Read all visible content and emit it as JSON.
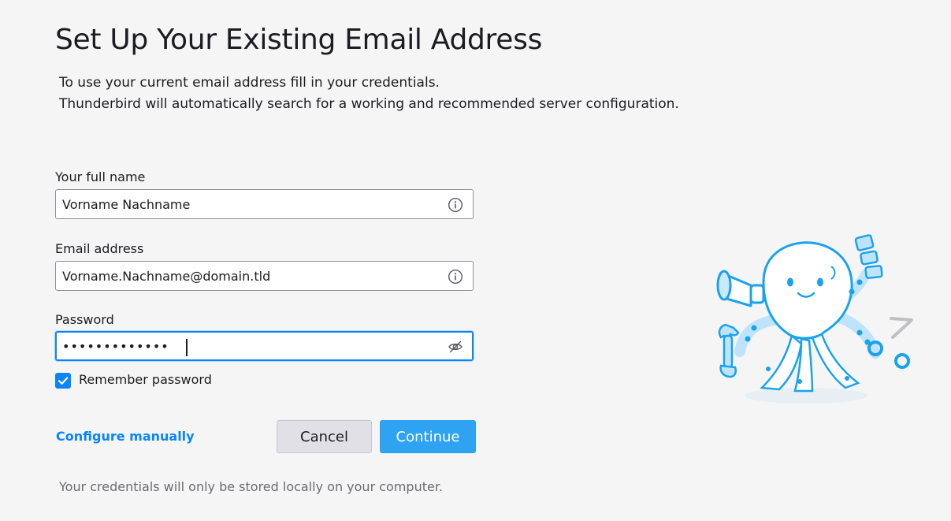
{
  "header": {
    "title": "Set Up Your Existing Email Address",
    "description_line1": "To use your current email address fill in your credentials.",
    "description_line2": "Thunderbird will automatically search for a working and recommended server configuration."
  },
  "form": {
    "full_name": {
      "label": "Your full name",
      "value": "Vorname Nachname",
      "icon": "info-icon"
    },
    "email": {
      "label": "Email address",
      "value": "Vorname.Nachname@domain.tld",
      "icon": "info-icon"
    },
    "password": {
      "label": "Password",
      "value": "•••••••••••••",
      "icon": "eye-slash-icon"
    },
    "remember_password": {
      "label": "Remember password",
      "checked": true
    }
  },
  "actions": {
    "configure_manually": "Configure manually",
    "cancel": "Cancel",
    "continue": "Continue"
  },
  "footer": {
    "note": "Your credentials will only be stored locally on your computer."
  },
  "colors": {
    "accent": "#0a84ff",
    "continue_button": "#2ea3f2",
    "background": "#f5f5f6"
  },
  "illustration": {
    "name": "octopus-mascot"
  }
}
